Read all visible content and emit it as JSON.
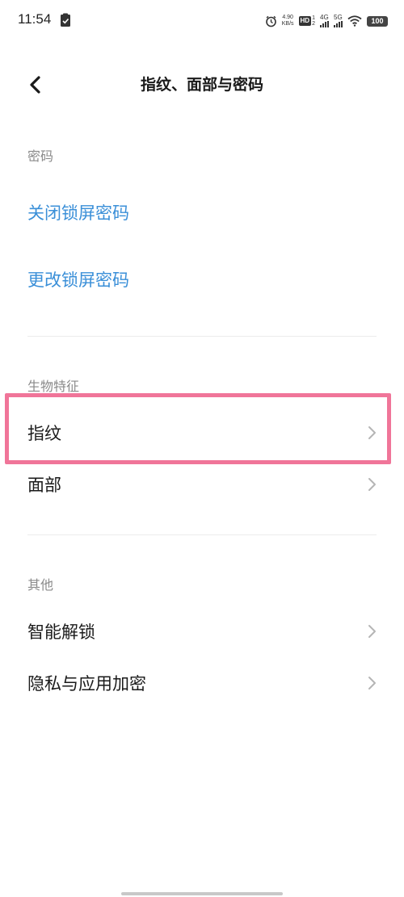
{
  "status": {
    "time": "11:54",
    "speed_value": "4.90",
    "speed_unit": "KB/s",
    "hd_label": "HD",
    "hd_sup_top": "1",
    "hd_sup_bottom": "2",
    "net1": "4G",
    "net2": "5G",
    "battery": "100"
  },
  "header": {
    "title": "指纹、面部与密码"
  },
  "sections": {
    "password": {
      "header": "密码",
      "items": [
        "关闭锁屏密码",
        "更改锁屏密码"
      ]
    },
    "biometric": {
      "header": "生物特征",
      "items": [
        "指纹",
        "面部"
      ]
    },
    "other": {
      "header": "其他",
      "items": [
        "智能解锁",
        "隐私与应用加密"
      ]
    }
  },
  "colors": {
    "link": "#3a8fd8",
    "highlight": "#f07599",
    "section_header": "#8a8a8a"
  }
}
